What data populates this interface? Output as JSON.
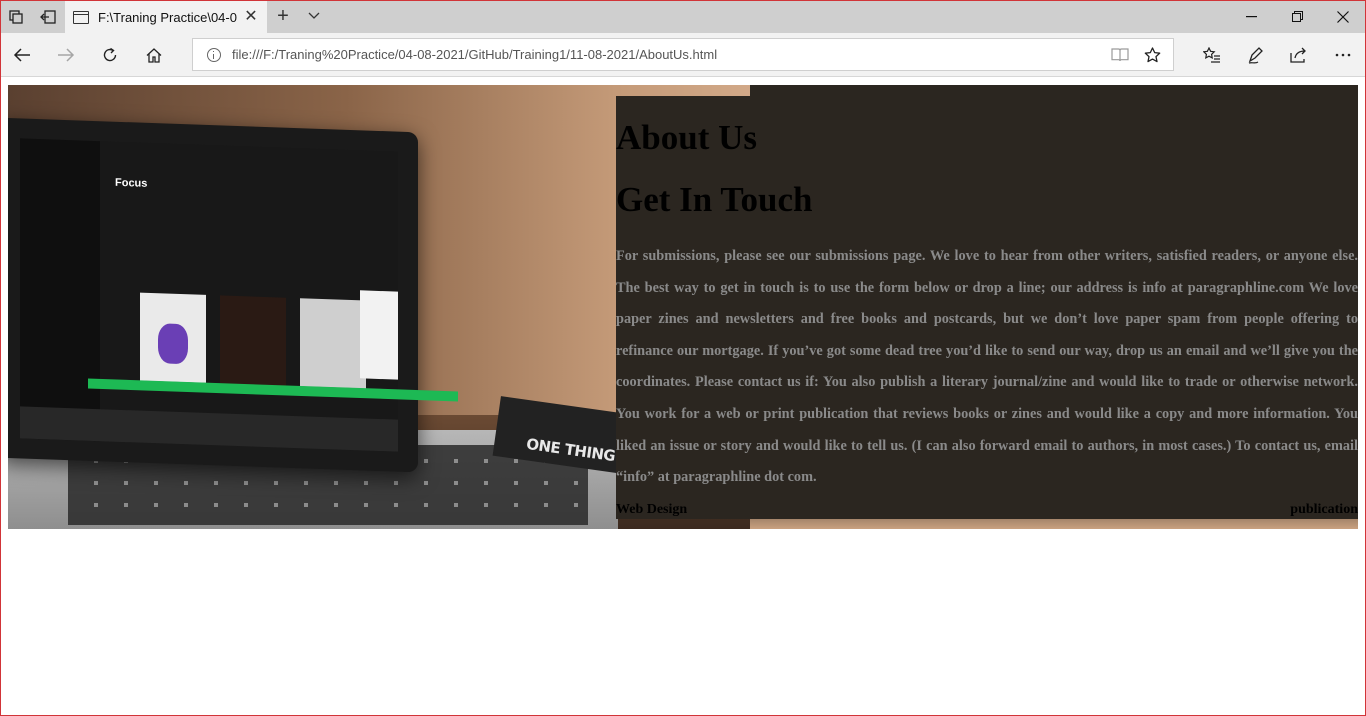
{
  "browser": {
    "tab_title": "F:\\Traning Practice\\04-0",
    "url": "file:///F:/Traning%20Practice/04-08-2021/GitHub/Training1/11-08-2021/AboutUs.html"
  },
  "page": {
    "heading_about": "About Us",
    "heading_touch": "Get In Touch",
    "paragraph": "For submissions, please see our submissions page. We love to hear from other writers, satisfied readers, or anyone else. The best way to get in touch is to use the form below or drop a line; our address is info at paragraphline.com We love paper zines and newsletters and free books and postcards, but we don’t love paper spam from people offering to refinance our mortgage. If you’ve got some dead tree you’d like to send our way, drop us an email and we’ll give you the coordinates. Please contact us if: You also publish a literary journal/zine and would like to trade or otherwise network. You work for a web or print publication that reviews books or zines and would like a copy and more information. You liked an issue or story and would like to tell us. (I can also forward email to authors, in most cases.) To contact us, email “info” at paragraphline dot com.",
    "footer_left": "Web Design",
    "footer_right": "publication"
  },
  "photo": {
    "screen_title": "Focus",
    "book_text": "ONE THING"
  },
  "colors": {
    "panel_bg": "#2b2620",
    "paragraph": "#8a8a8a",
    "window_border": "#d13438"
  }
}
